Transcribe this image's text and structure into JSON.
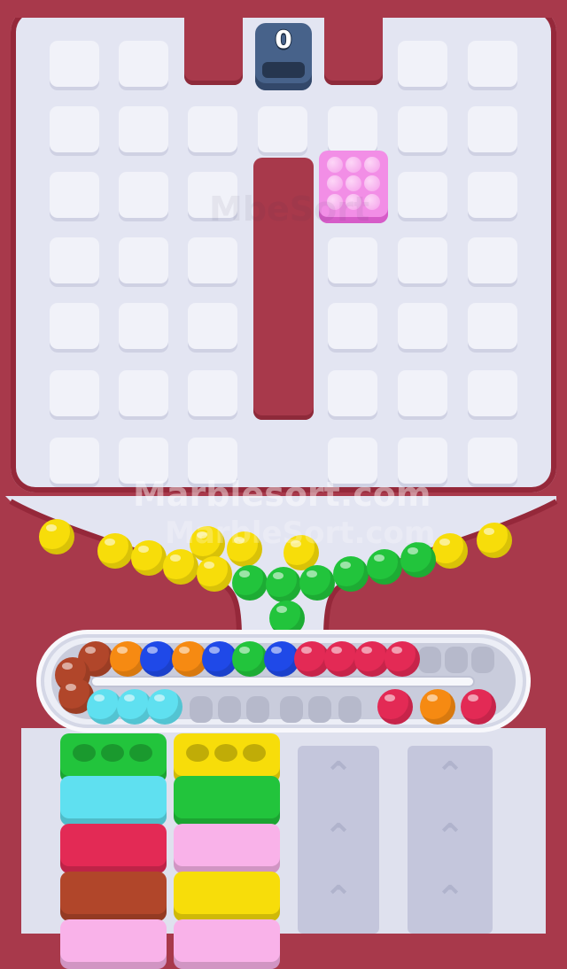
{
  "hud": {
    "counter": "0"
  },
  "watermark": {
    "main": "Marblesort.com",
    "echo": "MarbleSort.com",
    "faint": "MbeSort"
  },
  "colors": {
    "background": "#a8394b",
    "board": "#e3e5f2",
    "yellow": "#f7dd0a",
    "green": "#22c43c",
    "red": "#e32a55",
    "blue": "#1f49e8",
    "orange": "#f68a12",
    "brown": "#b1462a",
    "cyan": "#5fe0f0",
    "pink": "#f28ee6",
    "lightpink": "#f9b2e9"
  },
  "funnel_marbles": [
    "yellow",
    "yellow",
    "yellow",
    "yellow",
    "yellow",
    "yellow",
    "yellow",
    "yellow",
    "yellow",
    "yellow",
    "green",
    "green",
    "green",
    "green",
    "green",
    "green",
    "green",
    "green",
    "green"
  ],
  "conveyor": {
    "top_row": [
      "brown",
      "orange",
      "blue",
      "orange",
      "blue",
      "green",
      "blue",
      "red",
      "red",
      "red",
      "red"
    ],
    "left_turn": [
      "brown",
      "brown"
    ],
    "bottom_row": [
      "cyan",
      "cyan",
      "cyan",
      "red",
      "orange",
      "red"
    ]
  },
  "boxes": {
    "column_1": [
      "green",
      "cyan",
      "red",
      "brown",
      "lightpink"
    ],
    "column_2": [
      "yellow",
      "green",
      "lightpink",
      "yellow",
      "lightpink"
    ],
    "column_3": [],
    "column_4": []
  },
  "icons": {
    "locked_column": "chevron-up-icon"
  }
}
